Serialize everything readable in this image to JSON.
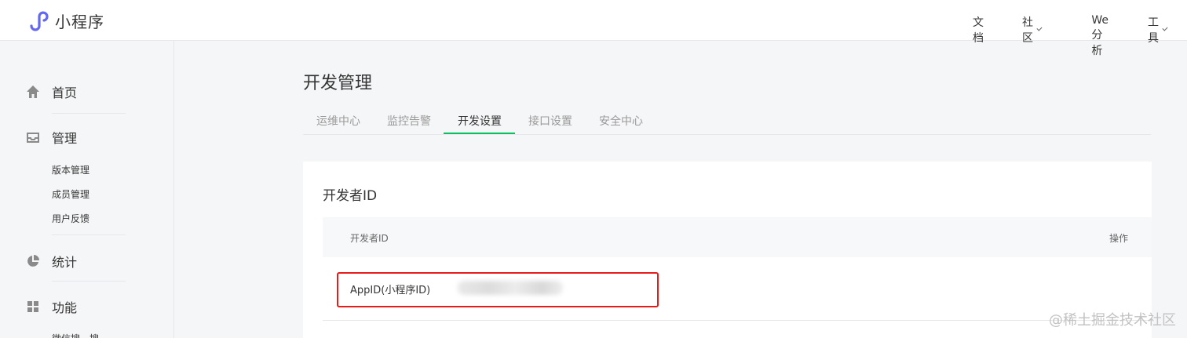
{
  "header": {
    "app_name": "小程序",
    "nav": [
      {
        "label": "文档",
        "has_dropdown": false
      },
      {
        "label": "社区",
        "has_dropdown": true
      },
      {
        "label": "We分析",
        "has_dropdown": false
      },
      {
        "label": "工具",
        "has_dropdown": true
      }
    ]
  },
  "sidebar": {
    "home": "首页",
    "manage": "管理",
    "manage_items": [
      "版本管理",
      "成员管理",
      "用户反馈"
    ],
    "stats": "统计",
    "features": "功能",
    "features_partial": "微信搜一搜"
  },
  "main": {
    "title": "开发管理",
    "tabs": [
      {
        "label": "运维中心",
        "active": false
      },
      {
        "label": "监控告警",
        "active": false
      },
      {
        "label": "开发设置",
        "active": true
      },
      {
        "label": "接口设置",
        "active": false
      },
      {
        "label": "安全中心",
        "active": false
      }
    ],
    "section_title": "开发者ID",
    "table": {
      "columns": [
        "开发者ID",
        "操作"
      ],
      "rows": [
        {
          "label": "AppID(小程序ID)",
          "value_obscured": true
        }
      ]
    }
  },
  "watermark": "@稀土掘金技术社区",
  "colors": {
    "accent": "#07c160",
    "highlight": "#e81a1a",
    "logo": "#6467f0"
  }
}
